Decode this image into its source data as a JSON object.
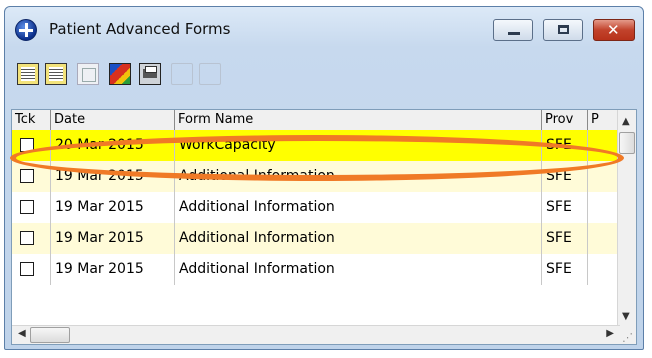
{
  "window": {
    "title": "Patient Advanced Forms",
    "icon": "plus-circle-icon",
    "controls": [
      "minimize",
      "maximize",
      "close"
    ]
  },
  "toolbar": {
    "buttons": [
      {
        "name": "new-form",
        "icon": "form-new-icon",
        "enabled": true
      },
      {
        "name": "edit-form",
        "icon": "form-edit-icon",
        "enabled": true
      },
      {
        "name": "view-form",
        "icon": "form-view-icon",
        "enabled": false
      },
      {
        "name": "color-form",
        "icon": "form-color-icon",
        "enabled": true
      },
      {
        "name": "print-form",
        "icon": "print-icon",
        "enabled": true
      },
      {
        "name": "blank-1",
        "icon": "blank-icon",
        "enabled": false
      },
      {
        "name": "blank-2",
        "icon": "blank-icon",
        "enabled": false
      }
    ]
  },
  "grid": {
    "columns": [
      "Tck",
      "Date",
      "Form Name",
      "Prov",
      "P"
    ],
    "rows": [
      {
        "tck": false,
        "date": "20 Mar 2015",
        "form_name": "WorkCapacity",
        "prov": "SFE",
        "p": "",
        "selected": true
      },
      {
        "tck": false,
        "date": "19 Mar 2015",
        "form_name": "Additional Information",
        "prov": "SFE",
        "p": ""
      },
      {
        "tck": false,
        "date": "19 Mar 2015",
        "form_name": "Additional Information",
        "prov": "SFE",
        "p": ""
      },
      {
        "tck": false,
        "date": "19 Mar 2015",
        "form_name": "Additional Information",
        "prov": "SFE",
        "p": ""
      },
      {
        "tck": false,
        "date": "19 Mar 2015",
        "form_name": "Additional Information",
        "prov": "SFE",
        "p": ""
      }
    ]
  },
  "colors": {
    "selected_row": "#ffff00",
    "alt_row": "#fffbd8",
    "normal_row": "#ffffff",
    "annotation": "#f07a26",
    "close_button": "#c2432c"
  }
}
